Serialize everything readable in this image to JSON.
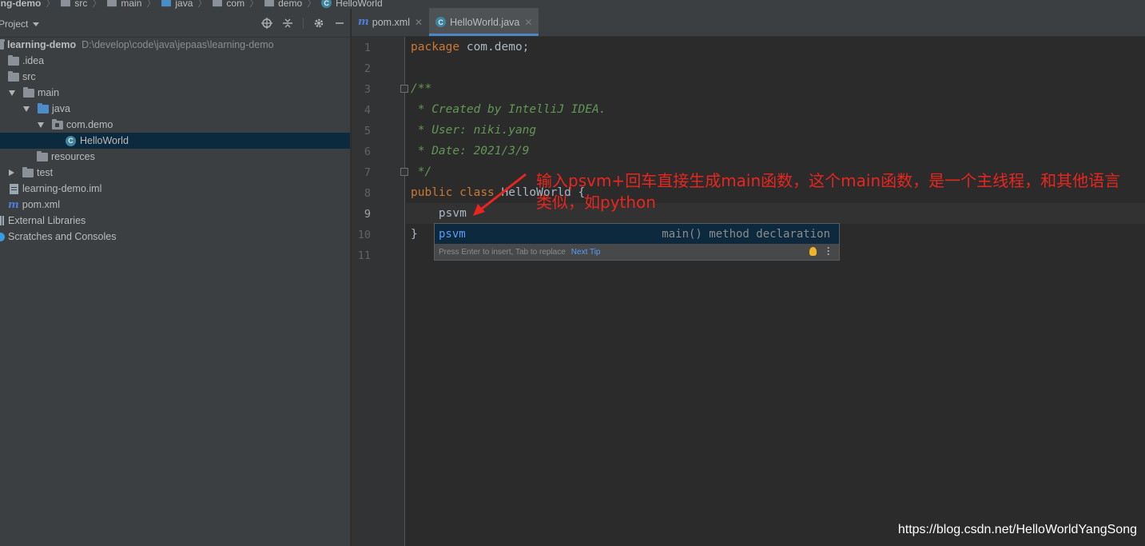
{
  "breadcrumb": {
    "items": [
      "ning-demo",
      "src",
      "main",
      "java",
      "com",
      "demo",
      "HelloWorld"
    ]
  },
  "project_panel": {
    "title": "Project",
    "tree": [
      {
        "label": "learning-demo",
        "path": "D:\\develop\\code\\java\\jepaas\\learning-demo"
      },
      {
        "label": ".idea"
      },
      {
        "label": "src"
      },
      {
        "label": "main"
      },
      {
        "label": "java"
      },
      {
        "label": "com.demo"
      },
      {
        "label": "HelloWorld"
      },
      {
        "label": "resources"
      },
      {
        "label": "test"
      },
      {
        "label": "learning-demo.iml"
      },
      {
        "label": "pom.xml"
      },
      {
        "label": "External Libraries"
      },
      {
        "label": "Scratches and Consoles"
      }
    ]
  },
  "tabs": [
    {
      "label": "pom.xml",
      "icon": "maven-icon"
    },
    {
      "label": "HelloWorld.java",
      "icon": "class-icon",
      "active": true
    }
  ],
  "editor": {
    "line_numbers": [
      "1",
      "2",
      "3",
      "4",
      "5",
      "6",
      "7",
      "8",
      "9",
      "10",
      "11"
    ],
    "current_line": "9",
    "lines": {
      "l1_kw": "package",
      "l1_rest": " com.demo;",
      "l3": "/**",
      "l4": " * Created by IntelliJ IDEA.",
      "l5": " * User: niki.yang",
      "l6": " * Date: 2021/3/9",
      "l7": " */",
      "l8_kw1": "public",
      "l8_kw2": "class",
      "l8_rest": " HelloWorld {",
      "l9": "    psvm",
      "l10": "}"
    }
  },
  "completion": {
    "item": "psvm",
    "description": "main() method declaration",
    "hint": "Press Enter to insert, Tab to replace",
    "next_tip": "Next Tip"
  },
  "annotation": {
    "text": "输入psvm+回车直接生成main函数，这个main函数，是一个主线程，和其他语言类似，如python"
  },
  "watermark": "https://blog.csdn.net/HelloWorldYangSong",
  "colors": {
    "keyword": "#cc7832",
    "comment": "#629755",
    "selection": "#0d293e",
    "annotation": "#e8261f"
  }
}
